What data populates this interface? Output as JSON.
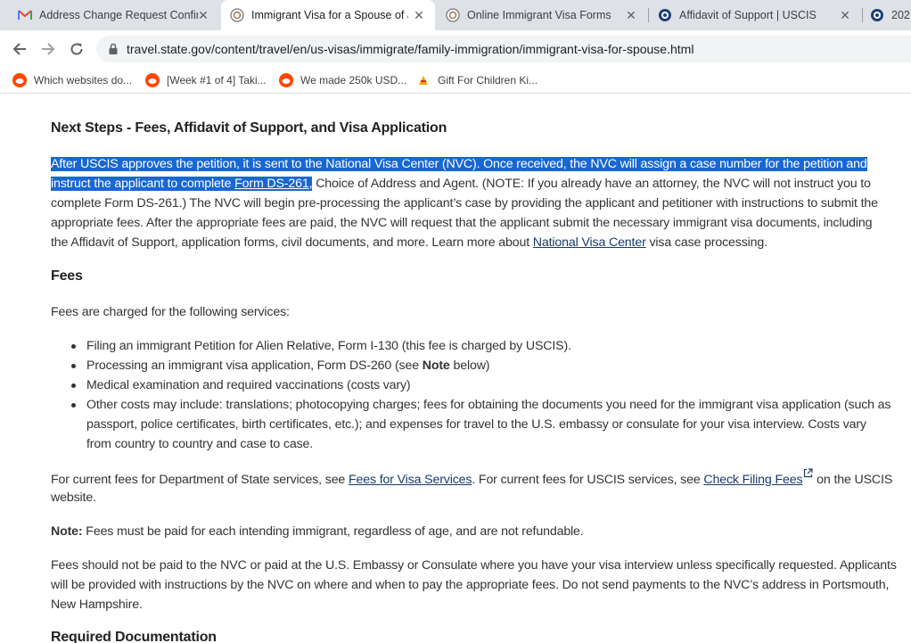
{
  "tabs": [
    {
      "title": "Address Change Request Confirm",
      "icon": "gmail-icon"
    },
    {
      "title": "Immigrant Visa for a Spouse of a",
      "icon": "uscis-seal-icon"
    },
    {
      "title": "Online Immigrant Visa Forms",
      "icon": "uscis-seal-icon"
    },
    {
      "title": "Affidavit of Support | USCIS",
      "icon": "dhs-seal-icon"
    },
    {
      "title": "202",
      "icon": "dhs-seal-icon"
    }
  ],
  "address_bar": {
    "url": "travel.state.gov/content/travel/en/us-visas/immigrate/family-immigration/immigrant-visa-for-spouse.html"
  },
  "bookmarks": [
    {
      "label": "Which websites do...",
      "icon": "reddit-icon"
    },
    {
      "label": "[Week #1 of 4] Taki...",
      "icon": "reddit-icon"
    },
    {
      "label": "We made 250k USD...",
      "icon": "reddit-icon"
    },
    {
      "label": "Gift For Children Ki...",
      "icon": "gift-icon"
    }
  ],
  "article": {
    "heading_next_steps": "Next Steps - Fees, Affidavit of Support, and Visa Application",
    "p1": {
      "l1": "After USCIS approves the petition, it is sent to the National Visa Center (NVC). Once received, the NVC will assign a case number for the petition and",
      "l2a": "instruct the applicant to complete ",
      "l2link": "Form DS-261",
      "l2b": ",",
      "l2c": " Choice of Address and Agent. (NOTE: If you already have an attorney, the NVC will not instruct you to",
      "l3": "complete Form DS-261.) The NVC will begin pre-processing the applicant’s case by providing the applicant and petitioner with instructions to submit the",
      "l4": "appropriate fees. After the appropriate fees are paid, the NVC will request that the applicant submit the necessary immigrant visa documents, including",
      "l5a": "the Affidavit of Support, application forms, civil documents, and more. Learn more about ",
      "l5link": "National Visa Center",
      "l5b": " visa case processing."
    },
    "heading_fees": "Fees",
    "fees_intro": "Fees are charged for the following services:",
    "list": {
      "i1": "Filing an immigrant Petition for Alien Relative, Form I-130 (this fee is charged by USCIS).",
      "i2a": "Processing an immigrant visa application, Form DS-260 (see ",
      "i2bold": "Note",
      "i2b": " below)",
      "i3": "Medical examination and required vaccinations (costs vary)",
      "i4l1": "Other costs may include: translations; photocopying charges; fees for obtaining the documents you need for the immigrant visa application (such as",
      "i4l2": "passport, police certificates, birth certificates, etc.); and expenses for travel to the U.S. embassy or consulate for your visa interview. Costs vary",
      "i4l3": "from country to country and case to case."
    },
    "p_current": {
      "a": "For current fees for Department of State services, see ",
      "link1": "Fees for Visa Services",
      "b": ". For current fees for USCIS services, see ",
      "link2": "Check Filing Fees",
      "c": " on the USCIS",
      "l2": "website."
    },
    "note": {
      "bold": "Note:",
      "text": " Fees must be paid for each intending immigrant, regardless of age, and are not refundable."
    },
    "p_nvc": {
      "l1": "Fees should not be paid to the NVC or paid at the U.S. Embassy or Consulate where you have your visa interview unless specifically requested. Applicants",
      "l2": "will be provided with instructions by the NVC on where and when to pay the appropriate fees. Do not send payments to the NVC’s address in Portsmouth,",
      "l3": "New Hampshire."
    },
    "heading_required": "Required Documentation"
  },
  "colors": {
    "selection": "#1967d2",
    "link": "#1a3a6b",
    "tabbar": "#dee1e6"
  }
}
